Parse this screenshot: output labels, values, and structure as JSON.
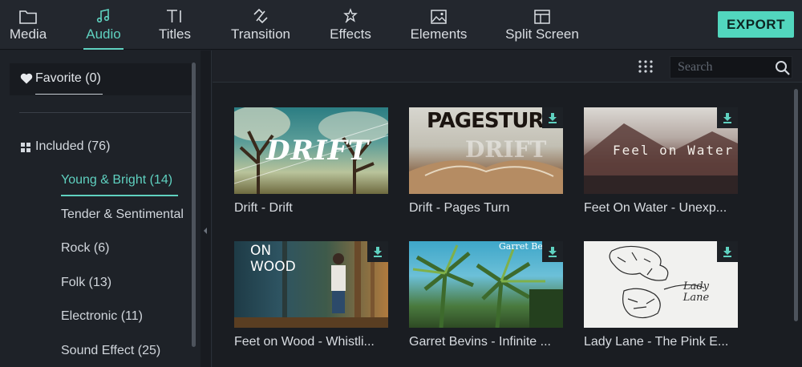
{
  "toolbar": {
    "tabs": [
      {
        "label": "Media",
        "icon": "folder-icon"
      },
      {
        "label": "Audio",
        "icon": "music-note-icon",
        "active": true
      },
      {
        "label": "Titles",
        "icon": "text-icon"
      },
      {
        "label": "Transition",
        "icon": "transition-icon"
      },
      {
        "label": "Effects",
        "icon": "effects-icon"
      },
      {
        "label": "Elements",
        "icon": "image-icon"
      },
      {
        "label": "Split Screen",
        "icon": "split-screen-icon"
      }
    ],
    "export_label": "EXPORT"
  },
  "sidebar": {
    "favorite_label": "Favorite (0)",
    "included_label": "Included (76)",
    "categories": [
      {
        "label": "Young & Bright (14)",
        "active": true
      },
      {
        "label": "Tender & Sentimental"
      },
      {
        "label": "Rock (6)"
      },
      {
        "label": "Folk (13)"
      },
      {
        "label": "Electronic (11)"
      },
      {
        "label": "Sound Effect (25)"
      }
    ]
  },
  "search": {
    "placeholder": "Search",
    "value": ""
  },
  "tracks": [
    {
      "title": "Drift - Drift",
      "thumb_text": "DRIFT",
      "downloadable": false
    },
    {
      "title": "Drift - Pages Turn",
      "thumb_text": "PAGESTURN",
      "downloadable": true
    },
    {
      "title": "Feet On Water - Unexp...",
      "thumb_text": "Feel on Water",
      "downloadable": true
    },
    {
      "title": "Feet on Wood - Whistli...",
      "thumb_text": "ON WOOD",
      "downloadable": true
    },
    {
      "title": "Garret Bevins - Infinite ...",
      "thumb_text": "Garret Bevins",
      "downloadable": true
    },
    {
      "title": "Lady Lane - The Pink E...",
      "thumb_text": "Lady Lane",
      "downloadable": true
    }
  ],
  "colors": {
    "accent": "#5fd1c0",
    "export_bg": "#52d6be",
    "background": "#1c2026"
  }
}
